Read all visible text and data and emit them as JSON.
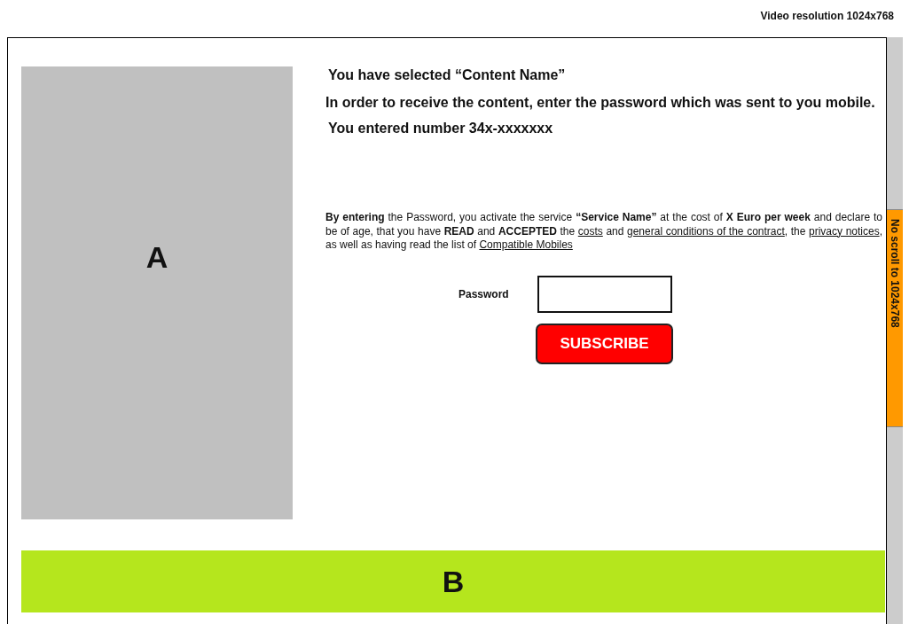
{
  "header": {
    "resolution_note": "Video resolution 1024x768"
  },
  "panel_a": {
    "label": "A"
  },
  "content": {
    "selected_line": "You have selected “Content Name”",
    "instruction": "In order to receive the content, enter the password which was sent to you mobile.",
    "entered_number": "You entered number 34x-xxxxxxx",
    "terms": [
      {
        "kind": "bold",
        "text": "By entering"
      },
      {
        "kind": "text",
        "text": " the Password, you activate the service "
      },
      {
        "kind": "bold",
        "text": "“Service Name”"
      },
      {
        "kind": "text",
        "text": " at the cost of "
      },
      {
        "kind": "bold",
        "text": "X Euro per week"
      },
      {
        "kind": "text",
        "text": " and declare to be of age, that you have "
      },
      {
        "kind": "bold",
        "text": "READ"
      },
      {
        "kind": "text",
        "text": " and "
      },
      {
        "kind": "bold",
        "text": "ACCEPTED"
      },
      {
        "kind": "text",
        "text": " the "
      },
      {
        "kind": "link",
        "text": "costs"
      },
      {
        "kind": "text",
        "text": " and "
      },
      {
        "kind": "link",
        "text": "general conditions of the contract"
      },
      {
        "kind": "text",
        "text": ", the "
      },
      {
        "kind": "link",
        "text": "privacy notices"
      },
      {
        "kind": "text",
        "text": ", as well as having read the list of "
      },
      {
        "kind": "link",
        "text": "Compatible Mobiles"
      }
    ],
    "password_label": "Password",
    "subscribe_button": "SUBSCRIBE"
  },
  "banner_b": {
    "label": "B"
  },
  "side_note": "No scroll to 1024x768"
}
